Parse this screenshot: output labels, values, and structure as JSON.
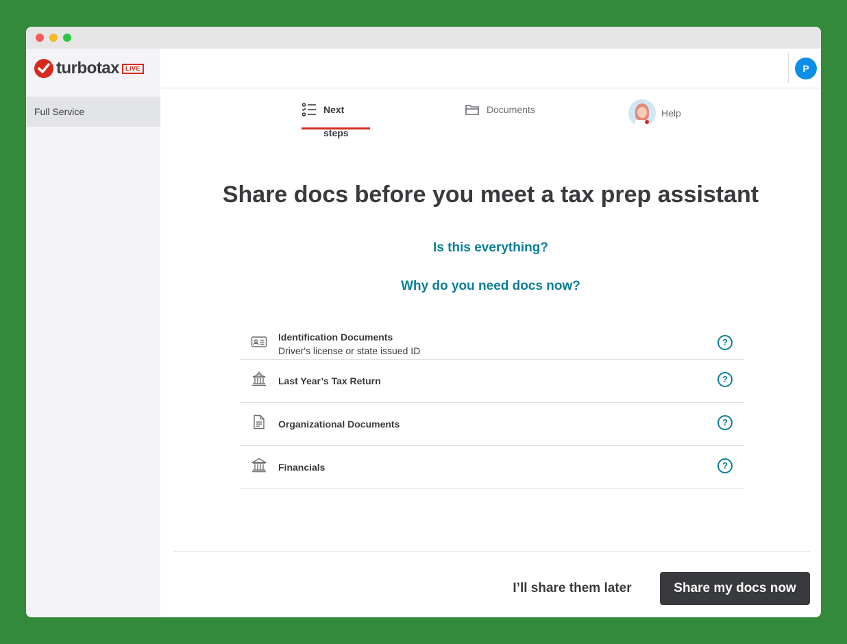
{
  "brand": {
    "name": "turbotax",
    "badge": "LIVE",
    "accent": "#d52b1e"
  },
  "sidebar": {
    "items": [
      {
        "label": "Full Service",
        "selected": true
      }
    ]
  },
  "header": {
    "user_initial": "P",
    "avatar_color": "#0d8fe6"
  },
  "tabs": [
    {
      "label": "Next steps",
      "icon": "checklist-icon",
      "active": true
    },
    {
      "label": "Documents",
      "icon": "folder-icon",
      "active": false
    },
    {
      "label": "Help",
      "icon": "assistant-avatar",
      "active": false
    }
  ],
  "main": {
    "title": "Share docs before you meet a tax prep assistant",
    "link_everything": "Is this everything?",
    "link_why": "Why do you need docs now?",
    "link_color": "#0a7e95",
    "documents": [
      {
        "title": "Identification Documents",
        "subtitle": "Driver's license or state issued ID",
        "icon": "id-card-icon"
      },
      {
        "title": "Last Year’s Tax Return",
        "subtitle": "",
        "icon": "government-building-icon"
      },
      {
        "title": "Organizational Documents",
        "subtitle": "",
        "icon": "document-icon"
      },
      {
        "title": "Financials",
        "subtitle": "",
        "icon": "bank-icon"
      }
    ],
    "help_glyph": "?"
  },
  "footer": {
    "later_label": "I’ll share them later",
    "now_label": "Share my docs now"
  }
}
